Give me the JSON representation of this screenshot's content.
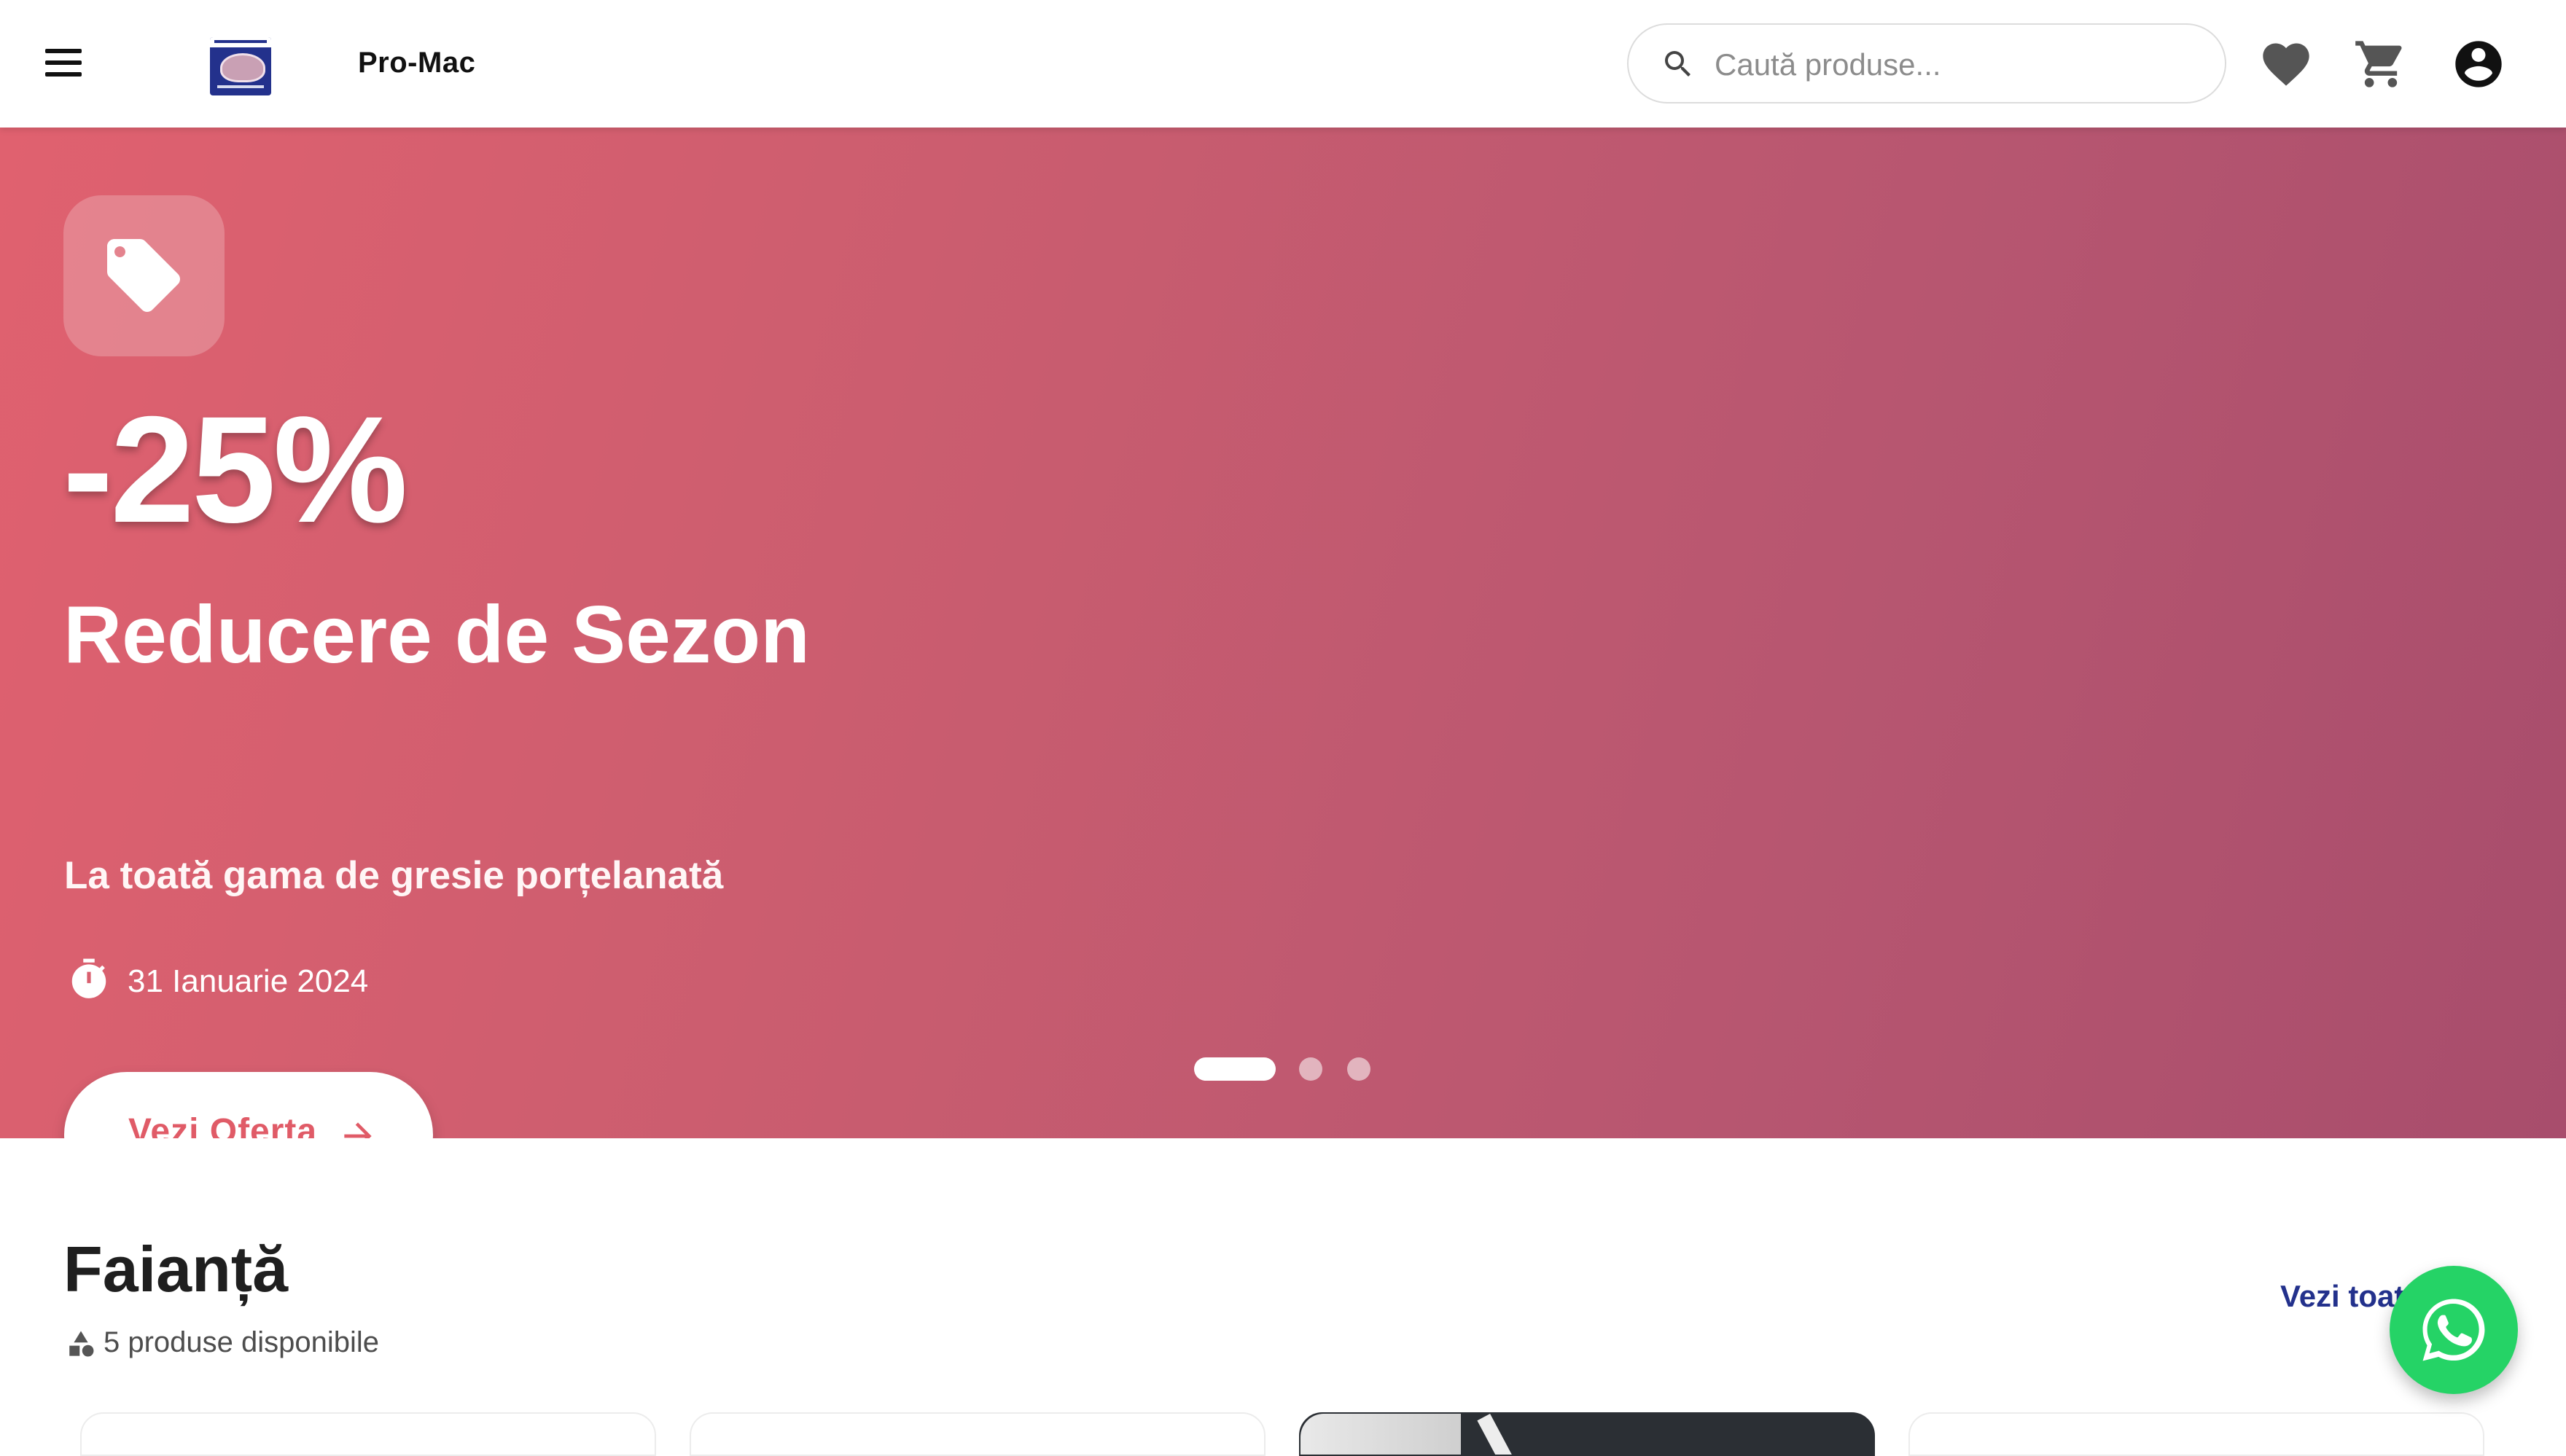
{
  "header": {
    "brand": "Pro-Mac",
    "logo_text": "PRO-MAC",
    "menu_icon": "menu-icon",
    "search": {
      "placeholder": "Caută produse...",
      "icon": "search-icon"
    },
    "icons": [
      "favorite-icon",
      "cart-icon",
      "account-icon"
    ]
  },
  "hero": {
    "badge_icon": "tag-icon",
    "discount": "-25%",
    "title": "Reducere de Sezon",
    "subtitle": "La toată gama de gresie porțelanată",
    "date_icon": "timer-icon",
    "date": "31 Ianuarie 2024",
    "cta_label": "Vezi Oferta",
    "cta_icon": "arrow-right-icon",
    "carousel": {
      "slides": 3,
      "active": 1
    },
    "colors": {
      "gradient_start": "#e0616f",
      "gradient_end": "#a84d6c",
      "cta_text": "#e05b67"
    }
  },
  "section": {
    "title": "Faianță",
    "count_icon": "categories-icon",
    "count_text": "5 produse disponibile",
    "see_all": "Vezi toate",
    "accent": "#23318c"
  },
  "whatsapp": {
    "icon": "whatsapp-icon",
    "color": "#25d366"
  }
}
